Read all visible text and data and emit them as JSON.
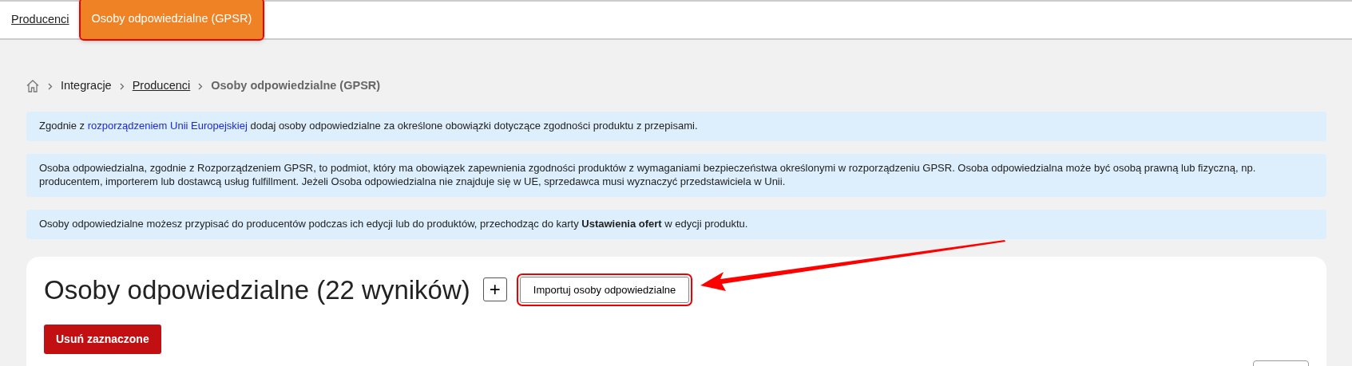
{
  "tabs": [
    {
      "label": "Producenci",
      "selected": false,
      "highlighted": false
    },
    {
      "label": "Osoby odpowiedzialne (GPSR)",
      "selected": true,
      "highlighted": true
    }
  ],
  "breadcrumb": [
    {
      "label": "Integracje",
      "kind": "text"
    },
    {
      "label": "Producenci",
      "kind": "link"
    },
    {
      "label": "Osoby odpowiedzialne (GPSR)",
      "kind": "current"
    }
  ],
  "notices": [
    {
      "kind": "link",
      "before": "Zgodnie z ",
      "link": "rozporządzeniem Unii Europejskiej",
      "after": " dodaj osoby odpowiedzialne za określone obowiązki dotyczące zgodności produktu z przepisami."
    },
    {
      "kind": "text",
      "text": "Osoba odpowiedzialna, zgodnie z Rozporządzeniem GPSR, to podmiot, który ma obowiązek zapewnienia zgodności produktów z wymaganiami bezpieczeństwa określonymi w rozporządzeniu GPSR. Osoba odpowiedzialna może być osobą prawną lub fizyczną, np. producentem, importerem lub dostawcą usług fulfillment. Jeżeli Osoba odpowiedzialna nie znajduje się w UE, sprzedawca musi wyznaczyć przedstawiciela w Unii."
    },
    {
      "kind": "text",
      "text": "Osoby odpowiedzialne możesz przypisać do producentów podczas ich edycji lub do produktów, przechodząc do karty **Ustawienia ofert** w edycji produktu."
    }
  ],
  "panel": {
    "title": "Osoby odpowiedzialne (22 wyników)",
    "add_button": "+",
    "import_button": {
      "label": "Importuj osoby odpowiedzialne",
      "highlighted": true
    },
    "delete_button": "Usuń zaznaczone"
  }
}
